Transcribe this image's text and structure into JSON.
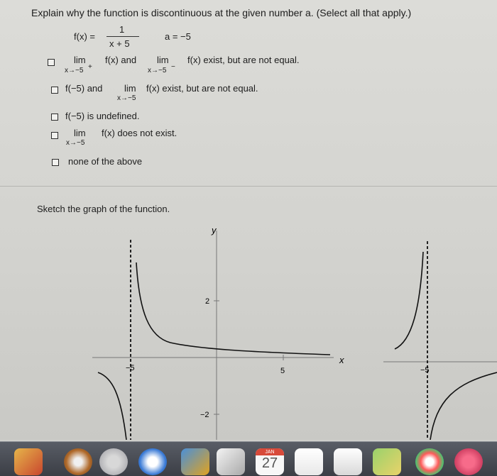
{
  "question": {
    "prompt": "Explain why the function is discontinuous at the given number a. (Select all that apply.)",
    "fx_label": "f(x) =",
    "numerator": "1",
    "denominator": "x + 5",
    "a_label": "a = −5"
  },
  "options": [
    {
      "pre": "lim",
      "sub": "x→−5",
      "sup": "+",
      "mid": "f(x) and",
      "lim2": "lim",
      "sub2": "x→−5",
      "sup2": "−",
      "post": "f(x) exist, but are not equal."
    },
    {
      "pre": "f(−5) and",
      "lim": "lim",
      "sub": "x→−5",
      "post": "f(x) exist, but are not equal."
    },
    {
      "text": "f(−5) is undefined."
    },
    {
      "lim": "lim",
      "sub": "x→−5",
      "post": "f(x) does not exist."
    },
    {
      "text": "none of the above"
    }
  ],
  "sketch": {
    "prompt": "Sketch the graph of the function.",
    "graph1": {
      "y_label": "y",
      "x_label": "x",
      "y_ticks": [
        "2",
        "−2"
      ],
      "x_ticks": [
        "−5",
        "5"
      ]
    },
    "graph2": {
      "x_ticks": [
        "−5"
      ]
    }
  },
  "dock": {
    "calendar_month": "JAN",
    "calendar_day": "27"
  }
}
